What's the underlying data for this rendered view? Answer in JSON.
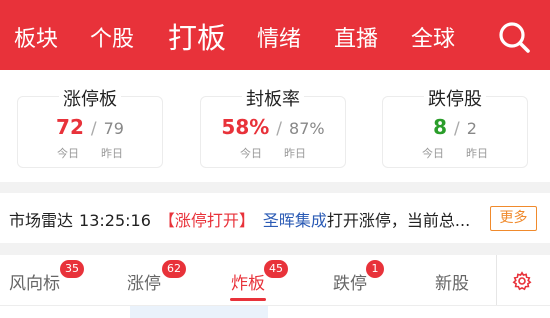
{
  "nav": {
    "items": [
      {
        "label": "板块"
      },
      {
        "label": "个股"
      },
      {
        "label": "打板",
        "active": true
      },
      {
        "label": "情绪"
      },
      {
        "label": "直播"
      },
      {
        "label": "全球"
      }
    ],
    "search_icon": "search-icon"
  },
  "stats": [
    {
      "title": "涨停板",
      "today": "72",
      "yesterday": "79",
      "today_label": "今日",
      "yesterday_label": "昨日",
      "color": "#e8323a"
    },
    {
      "title": "封板率",
      "today": "58%",
      "yesterday": "87%",
      "today_label": "今日",
      "yesterday_label": "昨日",
      "color": "#e8323a"
    },
    {
      "title": "跌停股",
      "today": "8",
      "yesterday": "2",
      "today_label": "今日",
      "yesterday_label": "昨日",
      "color": "#2a9d2a"
    }
  ],
  "stat_separator": "/",
  "radar": {
    "label": "市场雷达",
    "time": "13:25:16",
    "tag": "【涨停打开】",
    "stock": "圣晖集成",
    "message": "打开涨停，当前总...",
    "more": "更多"
  },
  "tabs": [
    {
      "label": "风向标",
      "badge": "35"
    },
    {
      "label": "涨停",
      "badge": "62"
    },
    {
      "label": "炸板",
      "badge": "45",
      "active": true
    },
    {
      "label": "跌停",
      "badge": "1"
    },
    {
      "label": "新股",
      "badge": ""
    }
  ],
  "colors": {
    "brand": "#e8323a",
    "accent_orange": "#f08a2c",
    "link_blue": "#2b5bb5",
    "green": "#2a9d2a"
  }
}
